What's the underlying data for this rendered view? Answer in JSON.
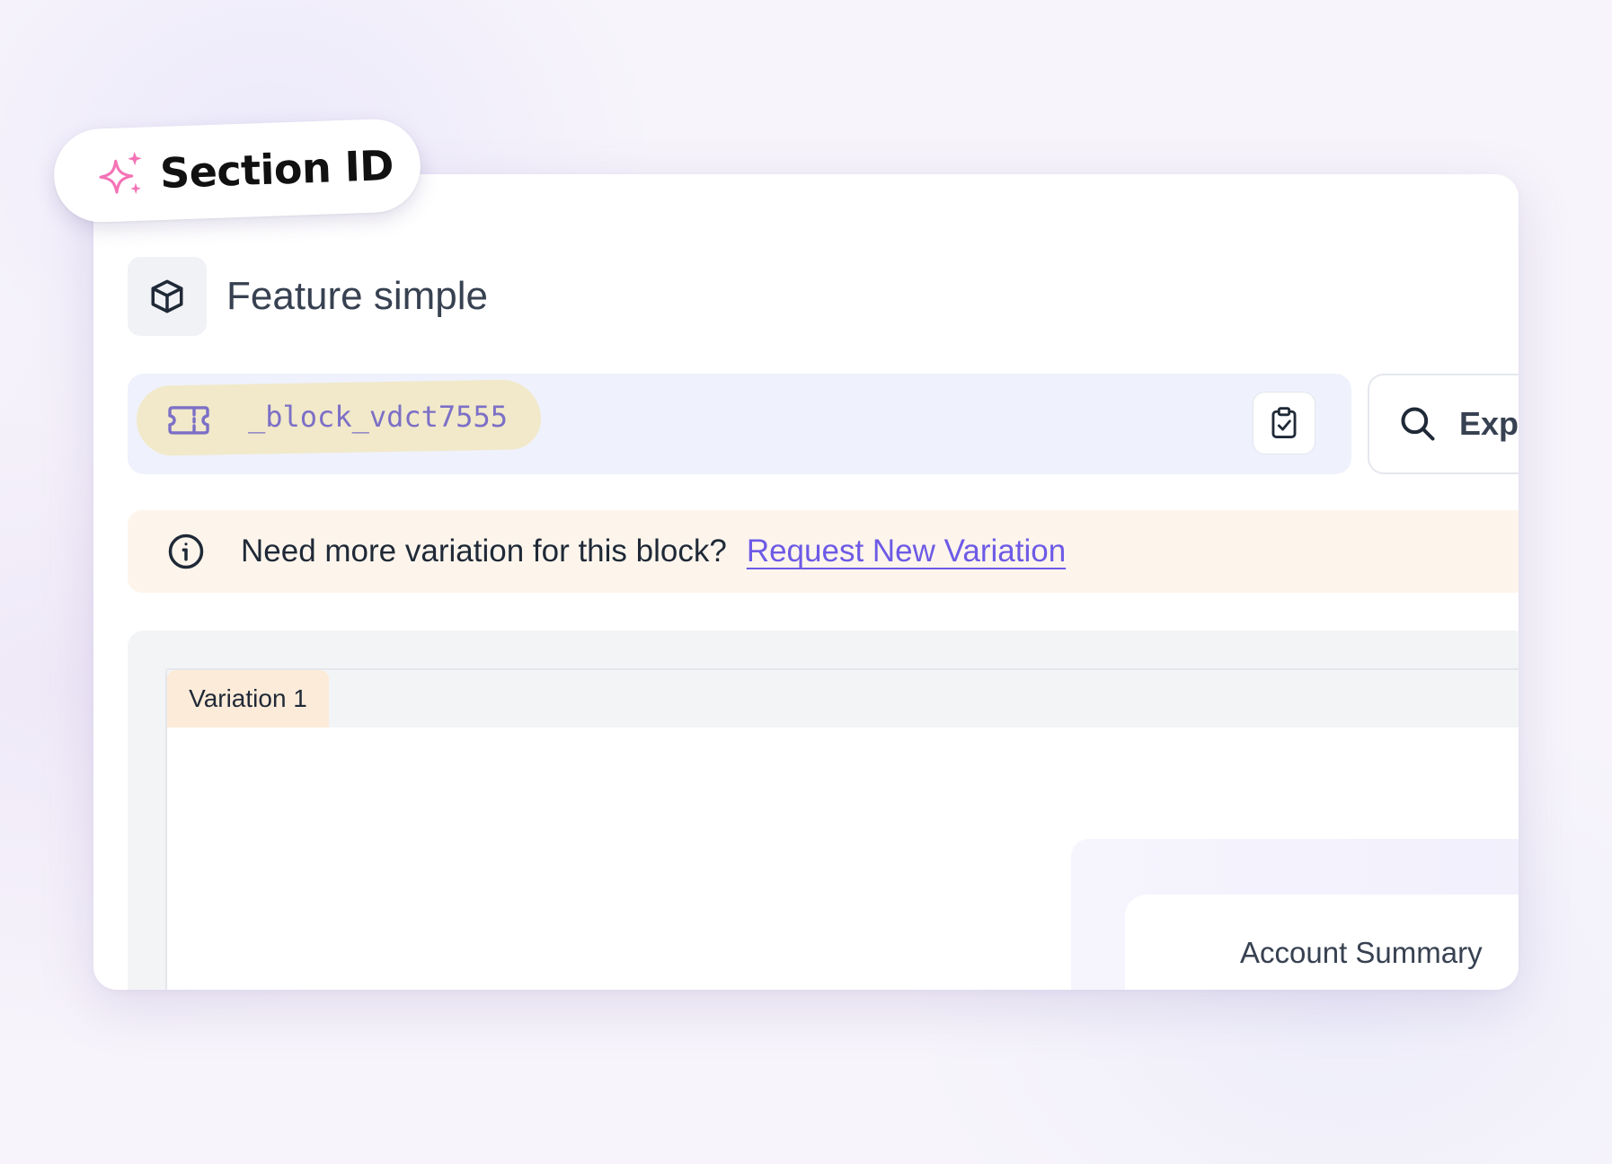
{
  "badge": {
    "label": "Section ID",
    "icon": "sparkles-icon",
    "icon_color": "#f472b6"
  },
  "feature": {
    "icon": "cube-icon",
    "title": "Feature simple"
  },
  "section_id_bar": {
    "icon": "ticket-icon",
    "id_value": "_block_vdct7555",
    "copy_icon": "clipboard-check-icon",
    "highlight_color": "#f1e9c9",
    "id_color": "#7c6fc7"
  },
  "explore": {
    "icon": "search-icon",
    "label": "Expl"
  },
  "info_banner": {
    "icon": "info-icon",
    "message": "Need more variation for this block?",
    "link_label": "Request New Variation",
    "link_color": "#6d5ae6"
  },
  "preview": {
    "tabs": [
      {
        "label": "Variation 1",
        "active": true
      }
    ],
    "content": {
      "card_title": "Account Summary"
    }
  }
}
